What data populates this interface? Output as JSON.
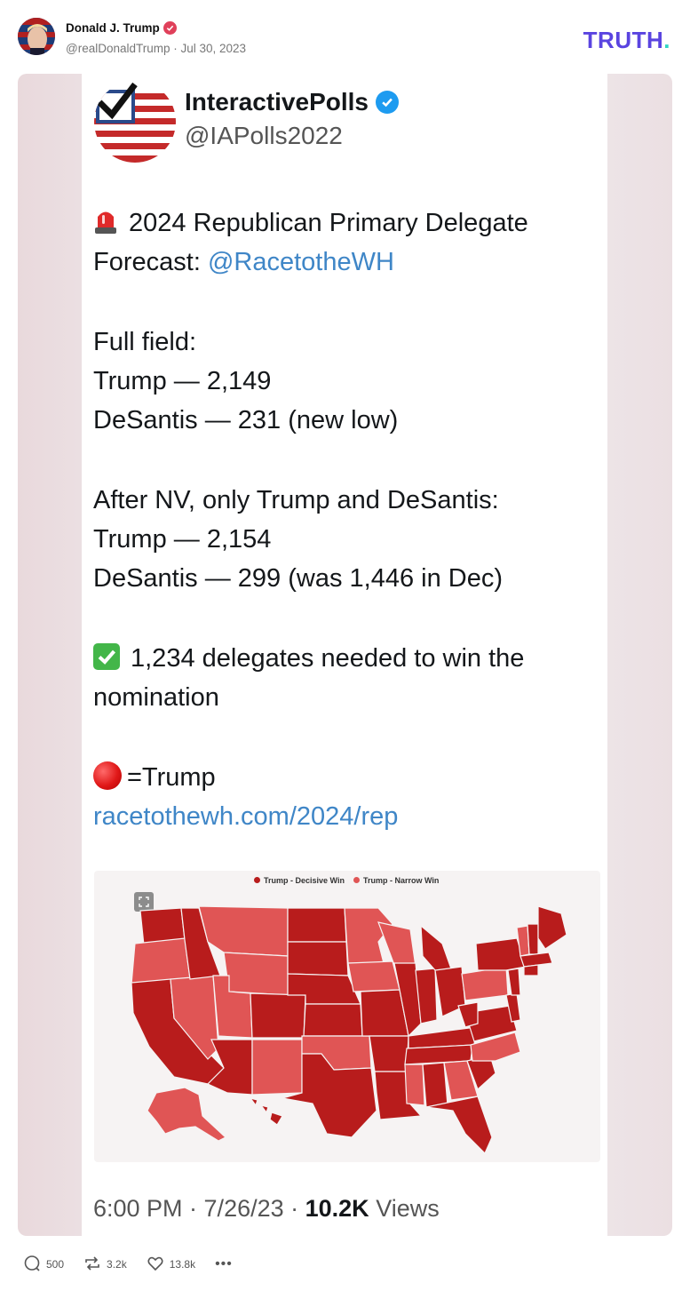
{
  "post": {
    "author_name": "Donald J. Trump",
    "author_meta": "@realDonaldTrump · Jul 30, 2023",
    "brand": "TRUTH",
    "brand_dot": "."
  },
  "tweet": {
    "account_name": "InteractivePolls",
    "handle": "@IAPolls2022",
    "headline_1": "2024 Republican Primary Delegate",
    "headline_2_prefix": "Forecast: ",
    "headline_2_link": "@RacetotheWH",
    "full_field_label": "Full field:",
    "full_field_trump": "Trump — 2,149",
    "full_field_desantis": "DeSantis — 231 (new low)",
    "after_nv_label": "After NV, only Trump and DeSantis:",
    "after_nv_trump": "Trump — 2,154",
    "after_nv_desantis": "DeSantis — 299 (was 1,446 in Dec)",
    "needed_1": "1,234 delegates needed to win the",
    "needed_2": "nomination",
    "legend_key": "=Trump",
    "url": "racetothewh.com/2024/rep",
    "time": "6:00 PM · 7/26/23 · ",
    "views_count": "10.2K",
    "views_label": " Views"
  },
  "map": {
    "legend_decisive": "Trump - Decisive Win",
    "legend_narrow": "Trump - Narrow Win",
    "colors": {
      "decisive": "#b81c1c",
      "narrow": "#e05555"
    }
  },
  "actions": {
    "replies": "500",
    "retruths": "3.2k",
    "likes": "13.8k",
    "more": "•••"
  },
  "icons": [
    "verified-badge-icon",
    "blue-verified-icon",
    "siren-emoji-icon",
    "check-mark-emoji-icon",
    "red-circle-emoji-icon",
    "fullscreen-icon",
    "reply-icon",
    "retruth-icon",
    "like-icon",
    "more-icon"
  ]
}
